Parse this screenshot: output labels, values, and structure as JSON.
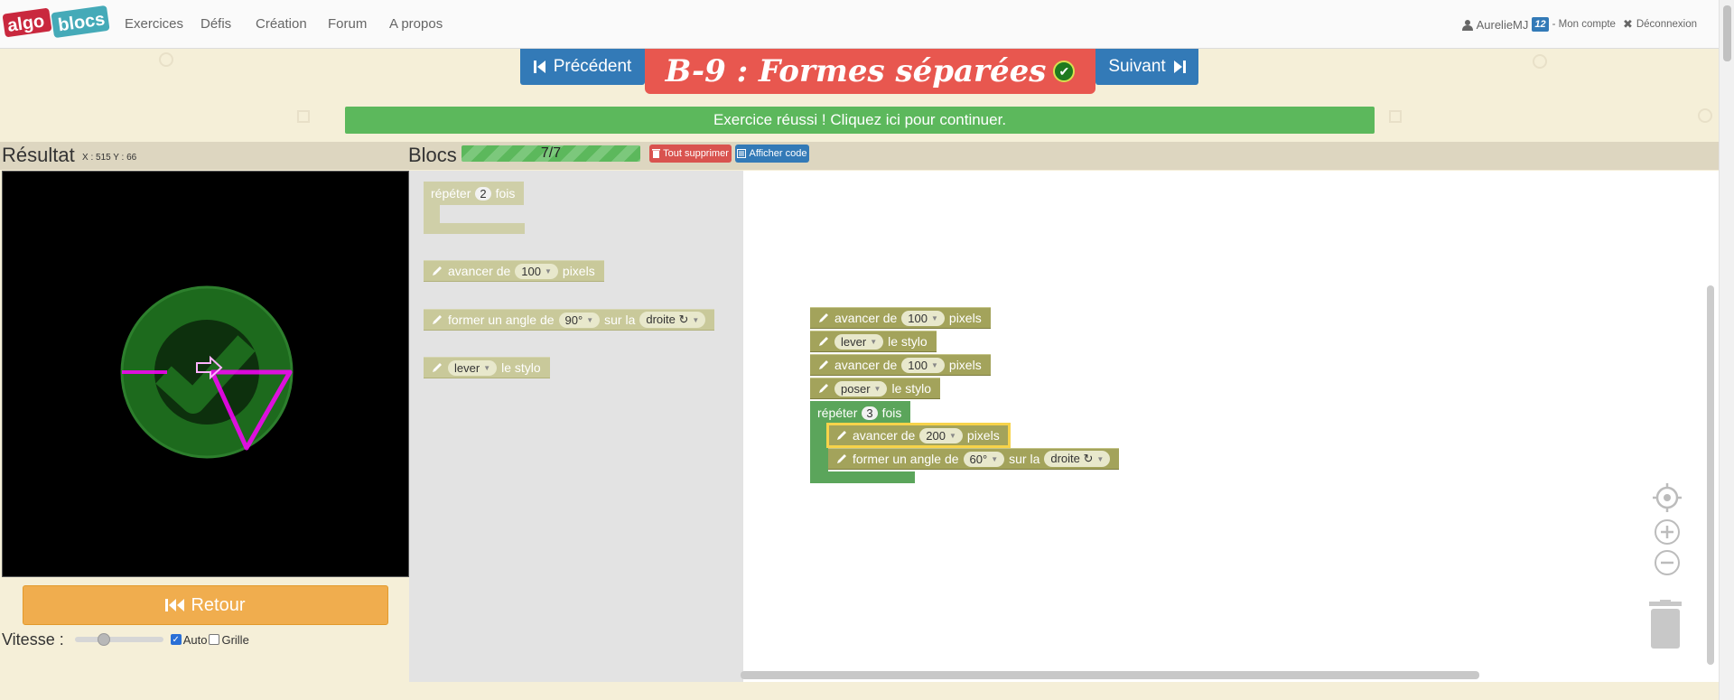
{
  "nav": {
    "logo_left": "algo",
    "logo_right": "blocs",
    "links": [
      "Exercices",
      "Défis",
      "Création",
      "Forum",
      "A propos"
    ],
    "user": "AurelieMJ",
    "rank": "12",
    "account": "- Mon compte",
    "logout": "Déconnexion"
  },
  "exercise": {
    "prev": "Précédent",
    "next": "Suivant",
    "title": "B-9 : Formes séparées",
    "success": "Exercice réussi ! Cliquez ici pour continuer."
  },
  "result": {
    "title": "Résultat",
    "coords": "X : 515 Y : 66",
    "retour": "Retour",
    "speed_label": "Vitesse :",
    "speed_level": 0.3,
    "auto_label": "Auto",
    "auto_checked": true,
    "grid_label": "Grille",
    "grid_checked": false
  },
  "blocks": {
    "title": "Blocs",
    "progress": "7/7",
    "delete_all": "Tout supprimer",
    "show_code": "Afficher code"
  },
  "toolbox": {
    "repeat": {
      "pre": "répéter",
      "count": "2",
      "post": "fois"
    },
    "forward": {
      "pre": "avancer de",
      "value": "100",
      "post": "pixels"
    },
    "turn": {
      "pre": "former un angle de",
      "value": "90°",
      "mid": "sur la",
      "dir": "droite ↻"
    },
    "pen": {
      "value": "lever",
      "post": "le stylo"
    }
  },
  "program": {
    "b1": {
      "pre": "avancer de",
      "value": "100",
      "post": "pixels"
    },
    "b2": {
      "value": "lever",
      "post": "le stylo"
    },
    "b3": {
      "pre": "avancer de",
      "value": "100",
      "post": "pixels"
    },
    "b4": {
      "value": "poser",
      "post": "le stylo"
    },
    "repeat": {
      "pre": "répéter",
      "count": "3",
      "post": "fois"
    },
    "b5": {
      "pre": "avancer de",
      "value": "200",
      "post": "pixels"
    },
    "b6": {
      "pre": "former un angle de",
      "value": "60°",
      "mid": "sur la",
      "dir": "droite ↻"
    }
  },
  "colors": {
    "accent_blue": "#337ab7",
    "title_red": "#e8574f",
    "success_green": "#5cb85c",
    "retour_orange": "#f0ad4e",
    "block_olive": "#a3a35b",
    "repeat_green": "#5ba55b",
    "trace_magenta": "#ff00ff"
  }
}
